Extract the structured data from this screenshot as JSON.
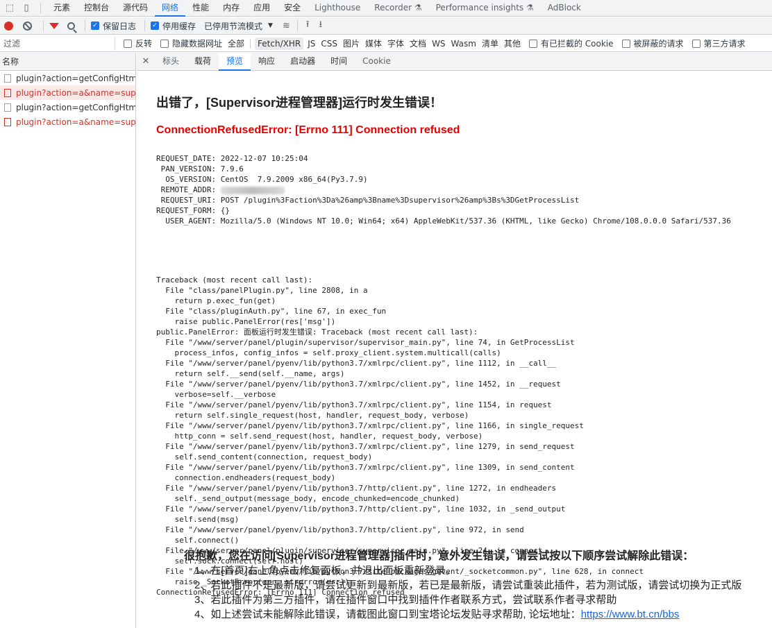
{
  "devtools": {
    "main_tabs": [
      "元素",
      "控制台",
      "源代码",
      "网络",
      "性能",
      "内存",
      "应用",
      "安全",
      "Lighthouse",
      "Recorder ⚗",
      "Performance insights ⚗",
      "AdBlock"
    ],
    "active_tab": "网络"
  },
  "toolbar": {
    "preserve_log": "保留日志",
    "disable_cache": "停用缓存",
    "throttle": "已停用节流模式"
  },
  "filter": {
    "placeholder": "过滤",
    "invert": "反转",
    "hide_data_urls": "隐藏数据网址",
    "all": "全部",
    "types": [
      "Fetch/XHR",
      "JS",
      "CSS",
      "图片",
      "媒体",
      "字体",
      "文档",
      "WS",
      "Wasm",
      "清单",
      "其他"
    ],
    "blocked_cookies": "有已拦截的 Cookie",
    "blocked_requests": "被屏蔽的请求",
    "third_party": "第三方请求"
  },
  "request_list": {
    "header": "名称",
    "items": [
      {
        "name": "plugin?action=getConfigHtml...",
        "status": "ok"
      },
      {
        "name": "plugin?action=a&name=supe...",
        "status": "error"
      },
      {
        "name": "plugin?action=getConfigHtml...",
        "status": "ok"
      },
      {
        "name": "plugin?action=a&name=supe...",
        "status": "error"
      }
    ]
  },
  "detail_tabs": [
    "标头",
    "载荷",
    "预览",
    "响应",
    "启动器",
    "时间",
    "Cookie"
  ],
  "active_detail_tab": "预览",
  "preview": {
    "title": "出错了，[Supervisor进程管理器]运行时发生错误！",
    "error": "ConnectionRefusedError: [Errno 111] Connection refused",
    "request_info": "REQUEST_DATE: 2022-12-07 10:25:04\n PAN_VERSION: 7.9.6\n  OS_VERSION: CentOS  7.9.2009 x86_64(Py3.7.9)\n REMOTE_ADDR: ",
    "request_info_2": " REQUEST_URI: POST /plugin%3Faction%3Da%26amp%3Bname%3Dsupervisor%26amp%3Bs%3DGetProcessList\nREQUEST_FORM: {}\n  USER_AGENT: Mozilla/5.0 (Windows NT 10.0; Win64; x64) AppleWebKit/537.36 (KHTML, like Gecko) Chrome/108.0.0.0 Safari/537.36",
    "traceback": "Traceback (most recent call last):\n  File \"class/panelPlugin.py\", line 2808, in a\n    return p.exec_fun(get)\n  File \"class/pluginAuth.py\", line 67, in exec_fun\n    raise public.PanelError(res['msg'])\npublic.PanelError: 面板运行时发生错误: Traceback (most recent call last):\n  File \"/www/server/panel/plugin/supervisor/supervisor_main.py\", line 74, in GetProcessList\n    process_infos, config_infos = self.proxy_client.system.multicall(calls)\n  File \"/www/server/panel/pyenv/lib/python3.7/xmlrpc/client.py\", line 1112, in __call__\n    return self.__send(self.__name, args)\n  File \"/www/server/panel/pyenv/lib/python3.7/xmlrpc/client.py\", line 1452, in __request\n    verbose=self.__verbose\n  File \"/www/server/panel/pyenv/lib/python3.7/xmlrpc/client.py\", line 1154, in request\n    return self.single_request(host, handler, request_body, verbose)\n  File \"/www/server/panel/pyenv/lib/python3.7/xmlrpc/client.py\", line 1166, in single_request\n    http_conn = self.send_request(host, handler, request_body, verbose)\n  File \"/www/server/panel/pyenv/lib/python3.7/xmlrpc/client.py\", line 1279, in send_request\n    self.send_content(connection, request_body)\n  File \"/www/server/panel/pyenv/lib/python3.7/xmlrpc/client.py\", line 1309, in send_content\n    connection.endheaders(request_body)\n  File \"/www/server/panel/pyenv/lib/python3.7/http/client.py\", line 1272, in endheaders\n    self._send_output(message_body, encode_chunked=encode_chunked)\n  File \"/www/server/panel/pyenv/lib/python3.7/http/client.py\", line 1032, in _send_output\n    self.send(msg)\n  File \"/www/server/panel/pyenv/lib/python3.7/http/client.py\", line 972, in send\n    self.connect()\n  File \"/www/server/panel/plugin/supervisor/supervisor_main.py\", line 24, in connect\n    self.sock.connect(self.host)\n  File \"/www/server/panel/pyenv/lib/python3.7/site-packages/gevent/_socketcommon.py\", line 628, in connect\n    raise _SocketError(err, strerror(err))\nConnectionRefusedError: [Errno 111] Connection refused",
    "help_title": "很抱歉，您在访问[Supervisor进程管理器]插件时，意外发生错误，请尝试按以下顺序尝试解除此错误：",
    "help_items": [
      "1、在[首页]右上角点击修复面板，并退出面板重新登录。",
      "2、若此插件不是最新版，请尝试更新到最新版，若已是最新版，请尝试重装此插件，若为测试版，请尝试切换为正式版",
      "3、若此插件为第三方插件，请在插件窗口中找到插件作者联系方式，尝试联系作者寻求帮助"
    ],
    "help_item_4_text": "4、如上述尝试未能解除此错误，请截图此窗口到宝塔论坛发贴寻求帮助, 论坛地址：",
    "help_link": "https://www.bt.cn/bbs"
  }
}
